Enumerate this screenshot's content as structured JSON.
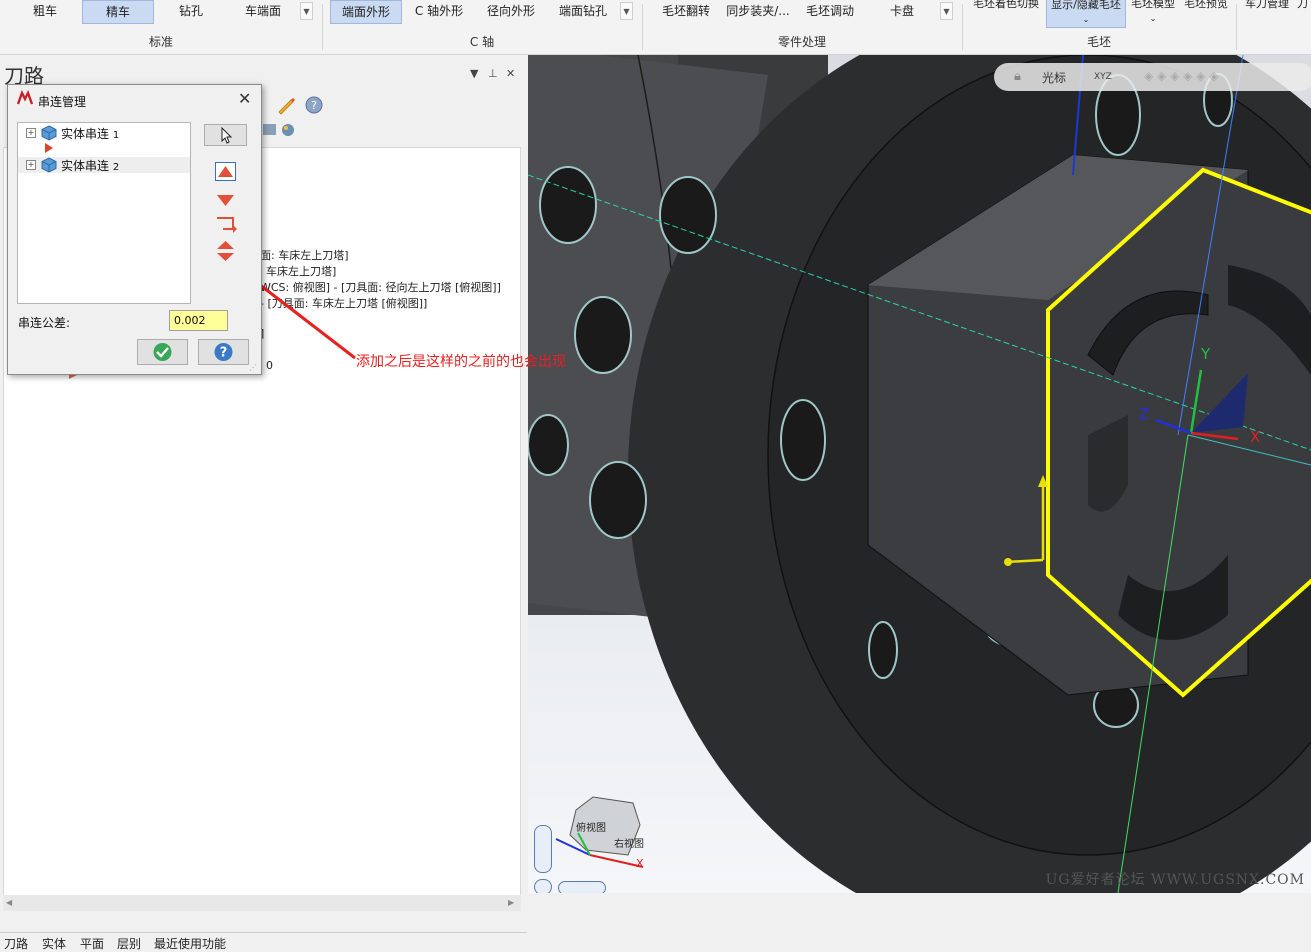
{
  "ribbon": {
    "groups": [
      {
        "name": "标准",
        "buttons": [
          "粗车",
          "精车",
          "钻孔",
          "车端面"
        ]
      },
      {
        "name": "C 轴",
        "buttons": [
          "端面外形",
          "C 轴外形",
          "径向外形",
          "端面钻孔"
        ]
      },
      {
        "name": "零件处理",
        "buttons": [
          "毛坯翻转",
          "同步装夹/...",
          "毛坯调动",
          "卡盘"
        ]
      },
      {
        "name": "毛坯",
        "buttons": [
          "毛坯着色切换",
          "显示/隐藏毛坯",
          "毛坯模型",
          "毛坯预览"
        ]
      },
      {
        "name": "",
        "buttons": [
          "车刀管理",
          "刀"
        ]
      }
    ],
    "selected": [
      "精车",
      "端面外形",
      "显示/隐藏毛坯"
    ]
  },
  "toolpath_panel": {
    "title": "刀路",
    "tree_fragments": [
      "面: 车床左上刀塔]",
      "车床左上刀塔]",
      "WCS: 俯视图] - [刀具面: 径向左上刀塔 [俯视图]]",
      "- [刀具面: 车床左上刀塔 [俯视图]]",
      "]",
      "0"
    ],
    "bottom_tabs": [
      "刀路",
      "实体",
      "平面",
      "层别",
      "最近使用功能"
    ]
  },
  "dialog": {
    "title": "串连管理",
    "chains": [
      {
        "label": "实体串连",
        "index": "1"
      },
      {
        "label": "实体串连",
        "index": "2"
      }
    ],
    "tolerance_label": "串连公差:",
    "tolerance_value": "0.002"
  },
  "viewport": {
    "toolbar_label": "光标",
    "toolbar_xyz": "XYZ",
    "viewcube_labels": [
      "俯视图",
      "右视图"
    ],
    "axis_labels": {
      "x": "X",
      "y": "Y",
      "z": "Z"
    },
    "watermark": "UG爱好者论坛 WWW.UGSNX.COM"
  },
  "annotation": "添加之后是这样的之前的也会出现",
  "colors": {
    "highlight": "#ffff00",
    "annotation": "#e82020",
    "selected_button": "#c9daf2"
  }
}
